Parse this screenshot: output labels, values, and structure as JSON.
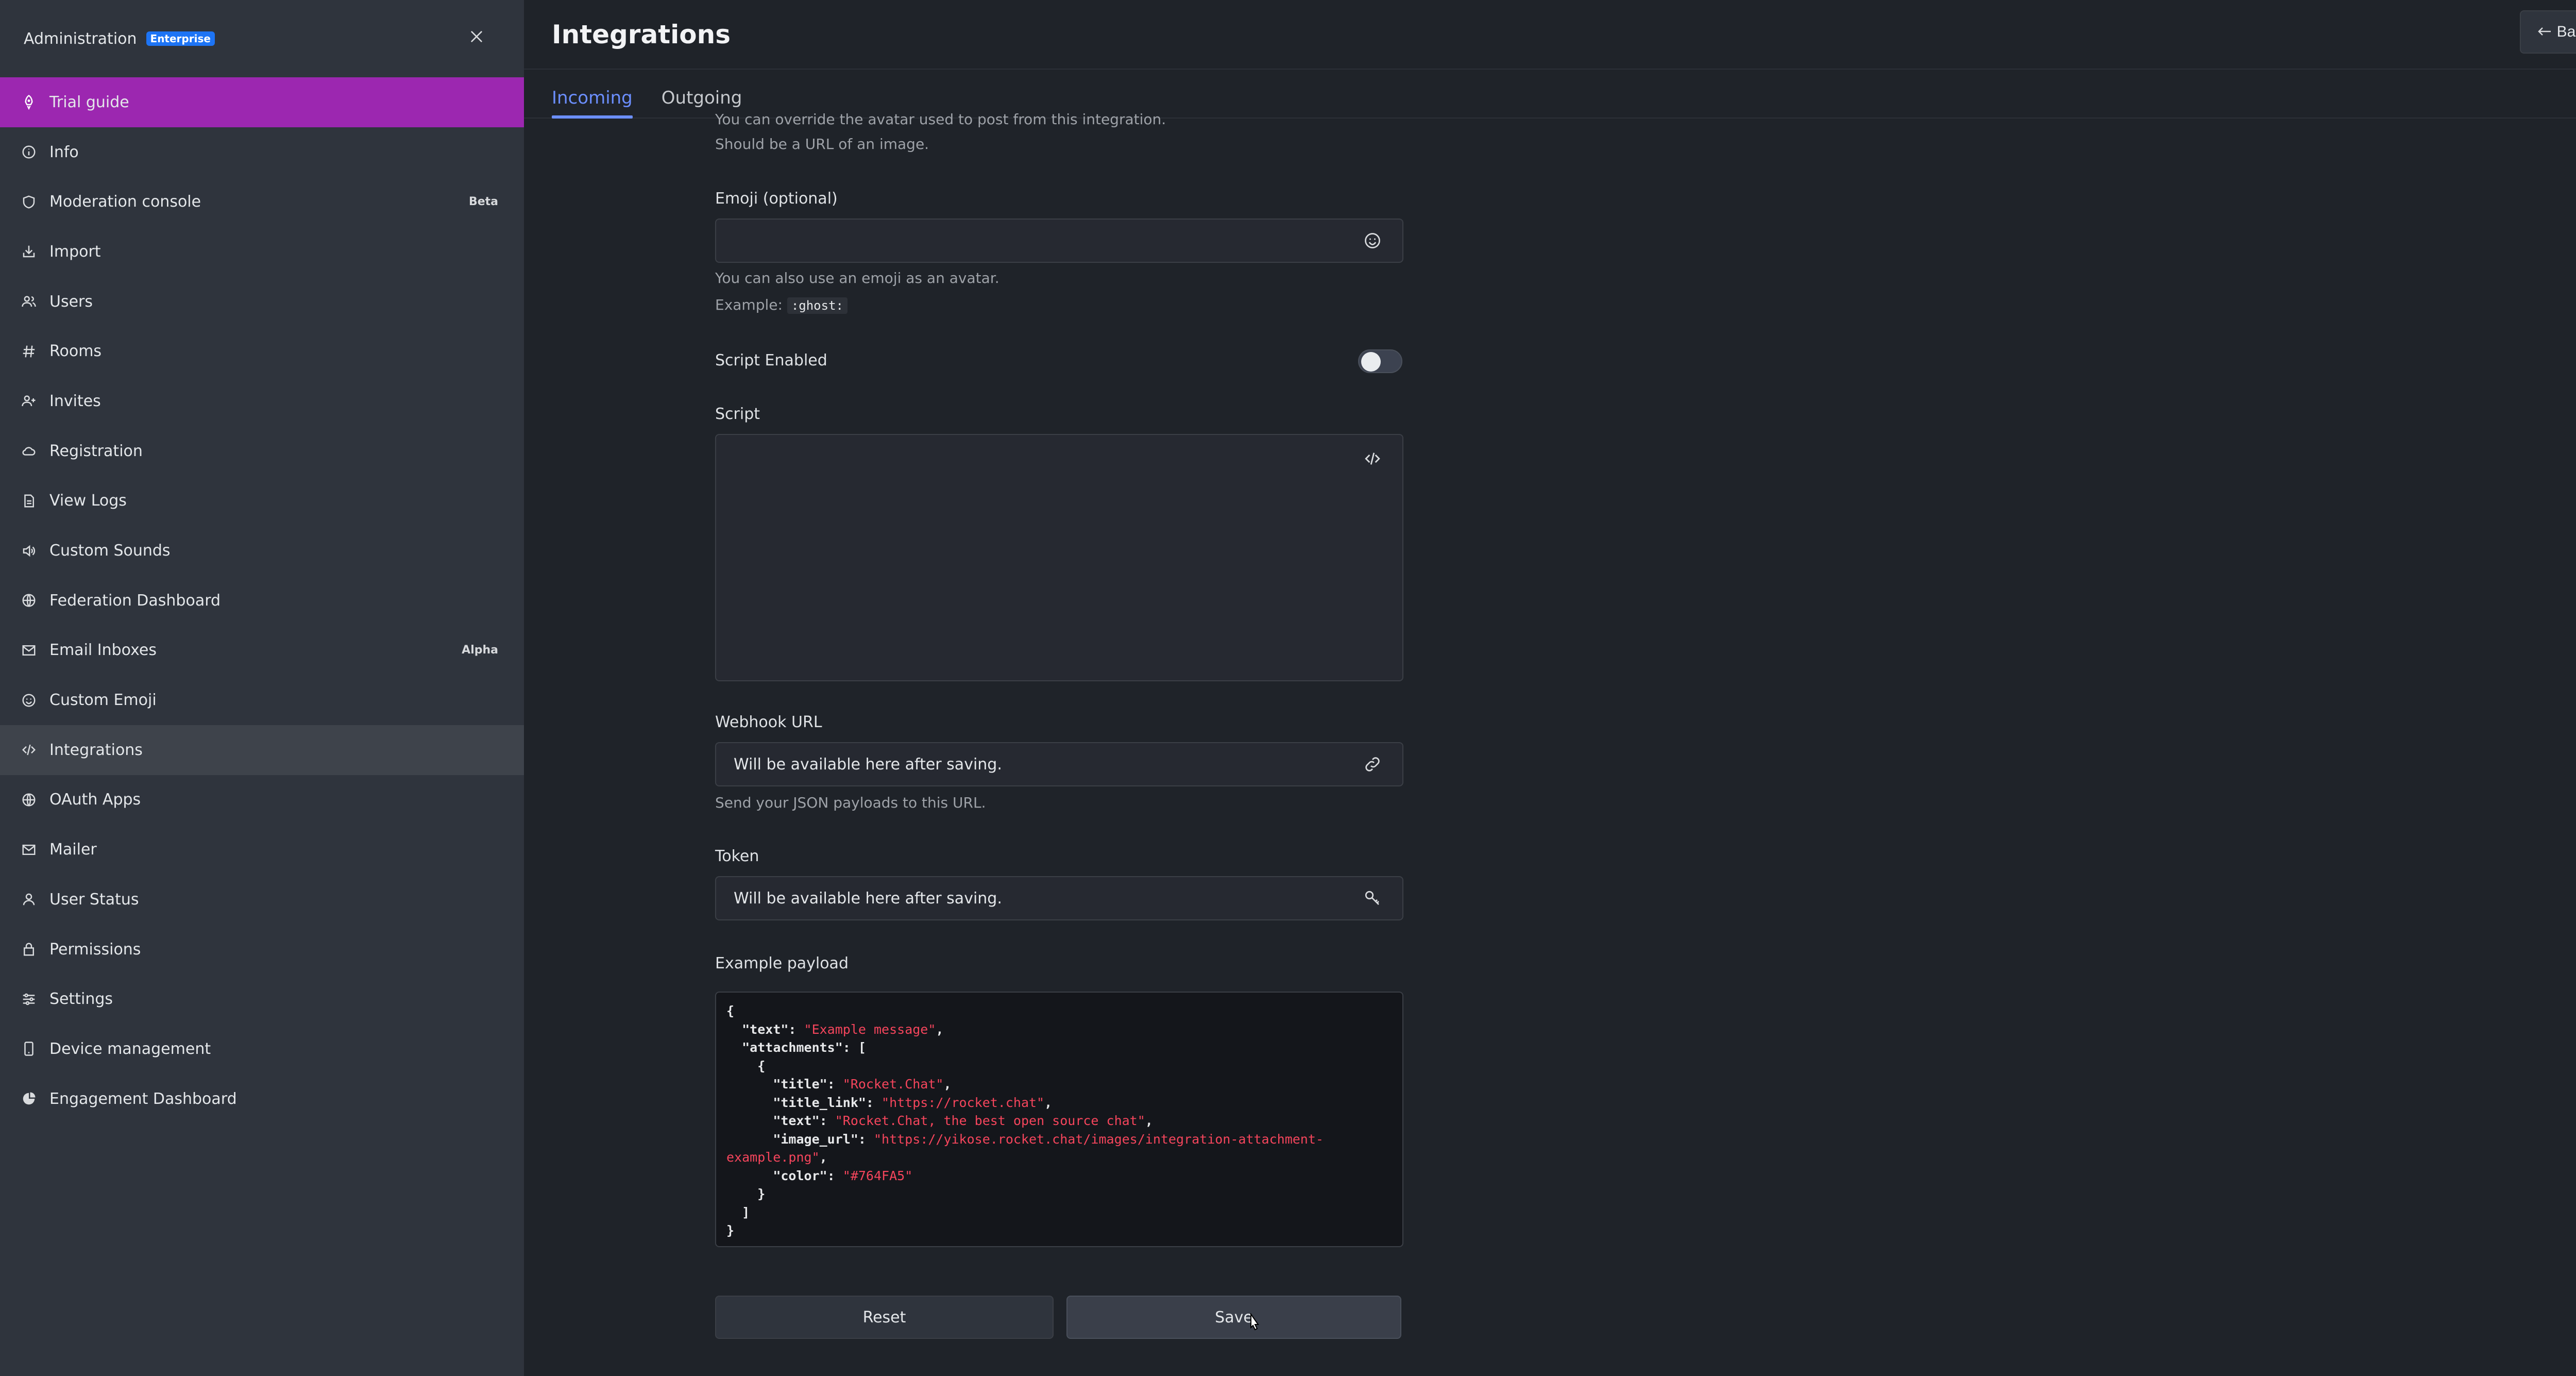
{
  "sidebar": {
    "title": "Administration",
    "badge": "Enterprise",
    "items": [
      {
        "label": "Trial guide",
        "icon": "rocket-icon",
        "tag": ""
      },
      {
        "label": "Info",
        "icon": "info-icon",
        "tag": ""
      },
      {
        "label": "Moderation console",
        "icon": "shield-icon",
        "tag": "Beta"
      },
      {
        "label": "Import",
        "icon": "import-icon",
        "tag": ""
      },
      {
        "label": "Users",
        "icon": "users-icon",
        "tag": ""
      },
      {
        "label": "Rooms",
        "icon": "hash-icon",
        "tag": ""
      },
      {
        "label": "Invites",
        "icon": "user-plus-icon",
        "tag": ""
      },
      {
        "label": "Registration",
        "icon": "cloud-icon",
        "tag": ""
      },
      {
        "label": "View Logs",
        "icon": "file-icon",
        "tag": ""
      },
      {
        "label": "Custom Sounds",
        "icon": "volume-icon",
        "tag": ""
      },
      {
        "label": "Federation Dashboard",
        "icon": "globe-icon",
        "tag": ""
      },
      {
        "label": "Email Inboxes",
        "icon": "mail-icon",
        "tag": "Alpha"
      },
      {
        "label": "Custom Emoji",
        "icon": "emoji-icon",
        "tag": ""
      },
      {
        "label": "Integrations",
        "icon": "code-icon",
        "tag": ""
      },
      {
        "label": "OAuth Apps",
        "icon": "globe-icon",
        "tag": ""
      },
      {
        "label": "Mailer",
        "icon": "mail-icon",
        "tag": ""
      },
      {
        "label": "User Status",
        "icon": "user-icon",
        "tag": ""
      },
      {
        "label": "Permissions",
        "icon": "lock-icon",
        "tag": ""
      },
      {
        "label": "Settings",
        "icon": "sliders-icon",
        "tag": ""
      },
      {
        "label": "Device management",
        "icon": "device-icon",
        "tag": ""
      },
      {
        "label": "Engagement Dashboard",
        "icon": "pie-icon",
        "tag": ""
      }
    ]
  },
  "header": {
    "title": "Integrations",
    "back_label": "Back"
  },
  "tabs": {
    "incoming": "Incoming",
    "outgoing": "Outgoing"
  },
  "form": {
    "avatar_hint_1": "You can override the avatar used to post from this integration.",
    "avatar_hint_2": "Should be a URL of an image.",
    "emoji_label": "Emoji (optional)",
    "emoji_value": "",
    "emoji_hint": "You can also use an emoji as an avatar.",
    "emoji_example_prefix": "Example:",
    "emoji_example_code": ":ghost:",
    "script_enabled_label": "Script Enabled",
    "script_label": "Script",
    "webhook_label": "Webhook URL",
    "webhook_value": "Will be available here after saving.",
    "webhook_hint": "Send your JSON payloads to this URL.",
    "token_label": "Token",
    "token_value": "Will be available here after saving.",
    "payload_label": "Example payload",
    "payload": {
      "open": "{",
      "k_text": "  \"text\": ",
      "v_text": "\"Example message\"",
      "k_attachments": "  \"attachments\": [",
      "obj_open": "    {",
      "k_title": "      \"title\": ",
      "v_title": "\"Rocket.Chat\"",
      "k_title_link": "      \"title_link\": ",
      "v_title_link": "\"https://rocket.chat\"",
      "k_text2": "      \"text\": ",
      "v_text2": "\"Rocket.Chat, the best open source chat\"",
      "k_image_url": "      \"image_url\": ",
      "v_image_url": "\"https://yikose.rocket.chat/images/integration-attachment-example.png\"",
      "k_color": "      \"color\": ",
      "v_color": "\"#764FA5\"",
      "obj_close": "    }",
      "arr_close": "  ]",
      "close": "}"
    },
    "reset_label": "Reset",
    "save_label": "Save"
  },
  "colors": {
    "active_item": "#9c27b0",
    "accent": "#6c8fff",
    "string": "#f5455c"
  }
}
